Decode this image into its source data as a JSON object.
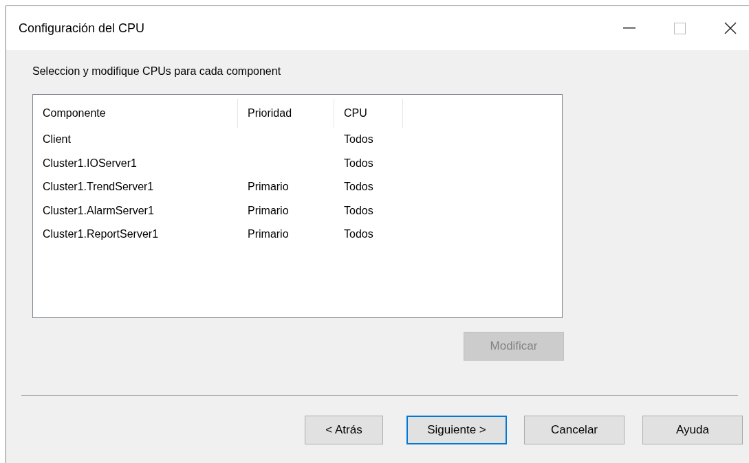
{
  "window": {
    "title": "Configuración del CPU"
  },
  "instruction": "Seleccion y modifique CPUs para cada component",
  "table": {
    "columns": [
      "Componente",
      "Prioridad",
      "CPU"
    ],
    "rows": [
      [
        "Client",
        "",
        "Todos"
      ],
      [
        "Cluster1.IOServer1",
        "",
        "Todos"
      ],
      [
        "Cluster1.TrendServer1",
        "Primario",
        "Todos"
      ],
      [
        "Cluster1.AlarmServer1",
        "Primario",
        "Todos"
      ],
      [
        "Cluster1.ReportServer1",
        "Primario",
        "Todos"
      ]
    ]
  },
  "modify_button": {
    "label": "Modificar",
    "disabled": true
  },
  "buttons": [
    {
      "label": "< Atrás",
      "focused": false
    },
    {
      "label": "Siguiente >",
      "focused": true
    },
    {
      "label": "Cancelar",
      "focused": false
    },
    {
      "label": "Ayuda",
      "focused": false
    }
  ]
}
